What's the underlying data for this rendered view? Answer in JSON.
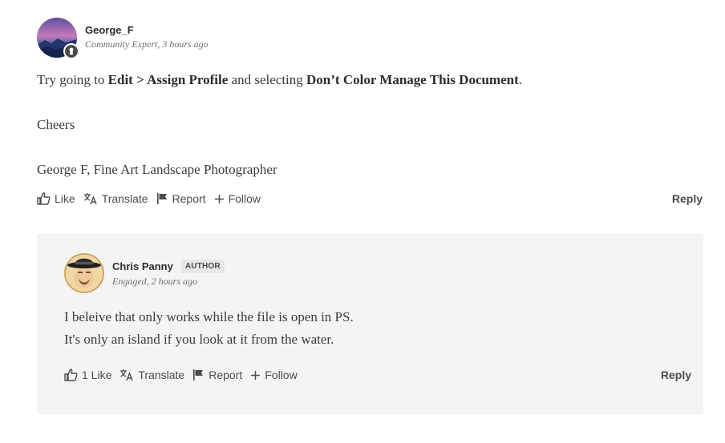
{
  "post": {
    "author": {
      "name": "George_F",
      "role": "Community Expert",
      "time": "3 hours ago"
    },
    "body": {
      "line1_pre": "Try going to ",
      "line1_bold1": "Edit > Assign Profile",
      "line1_mid": " and selecting ",
      "line1_bold2": "Don’t Color Manage This Document",
      "line1_post": ".",
      "line2": "Cheers",
      "line3": "George F, Fine Art Landscape Photographer"
    },
    "actions": {
      "like": "Like",
      "translate": "Translate",
      "report": "Report",
      "follow": "Follow",
      "reply": "Reply"
    }
  },
  "reply": {
    "author": {
      "name": "Chris Panny",
      "badge": "AUTHOR",
      "role": "Engaged",
      "time": "2 hours ago"
    },
    "body": {
      "line1": "I beleive that only works while the file is open in PS.",
      "line2": "It's only an island if you look at it from the water."
    },
    "actions": {
      "like": "1 Like",
      "translate": "Translate",
      "report": "Report",
      "follow": "Follow",
      "reply": "Reply"
    }
  },
  "colors": {
    "text": "#2c2c2c",
    "muted": "#6e6e6e",
    "reply_bg": "#f4f4f4",
    "badge_bg": "#e8e8e8"
  },
  "icons": {
    "like": "thumbs-up-icon",
    "translate": "translate-icon",
    "report": "flag-icon",
    "follow": "plus-icon"
  }
}
